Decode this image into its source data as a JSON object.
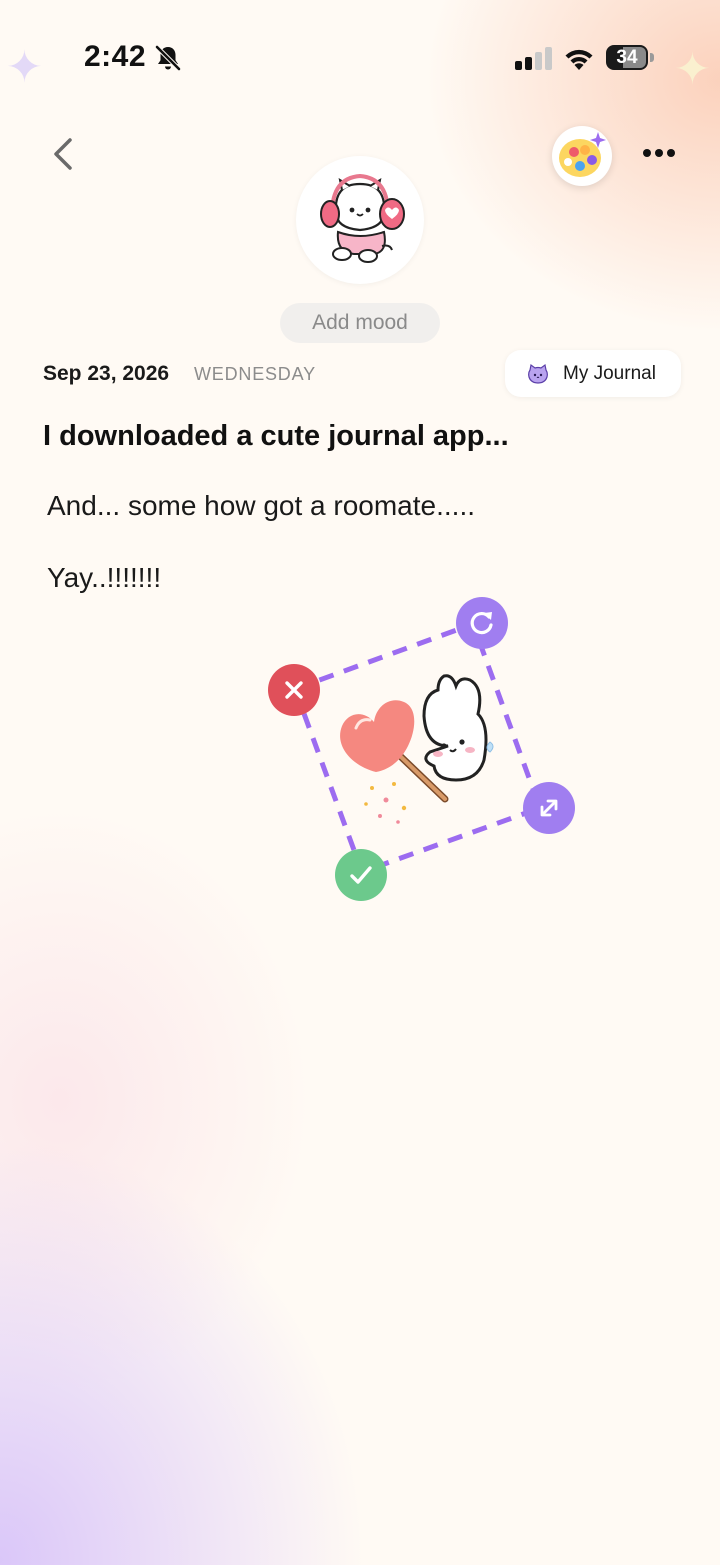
{
  "status_bar": {
    "time": "2:42",
    "battery_level": "34",
    "icons": [
      "bell-slash-icon",
      "cellular-signal-icon",
      "wifi-icon",
      "battery-icon"
    ]
  },
  "header": {
    "back_icon": "chevron-left-icon",
    "theme_icon": "palette-icon",
    "more_icon": "ellipsis-icon"
  },
  "mood": {
    "avatar": "bear-headphones-sticker",
    "add_label": "Add mood"
  },
  "entry": {
    "date": "Sep 23, 2026",
    "weekday": "WEDNESDAY",
    "journal_label": "My Journal",
    "title": "I downloaded a cute journal app...",
    "body_lines": [
      "And... some how got a roomate.....",
      "Yay..!!!!!!!"
    ]
  },
  "sticker": {
    "name": "bunny-with-heart-wand-sticker",
    "controls": [
      "delete",
      "rotate",
      "resize",
      "confirm"
    ]
  },
  "colors": {
    "accent_purple": "#a07ef0",
    "delete_red": "#e0505a",
    "confirm_green": "#6cc98c",
    "background": "#fffaf4"
  }
}
